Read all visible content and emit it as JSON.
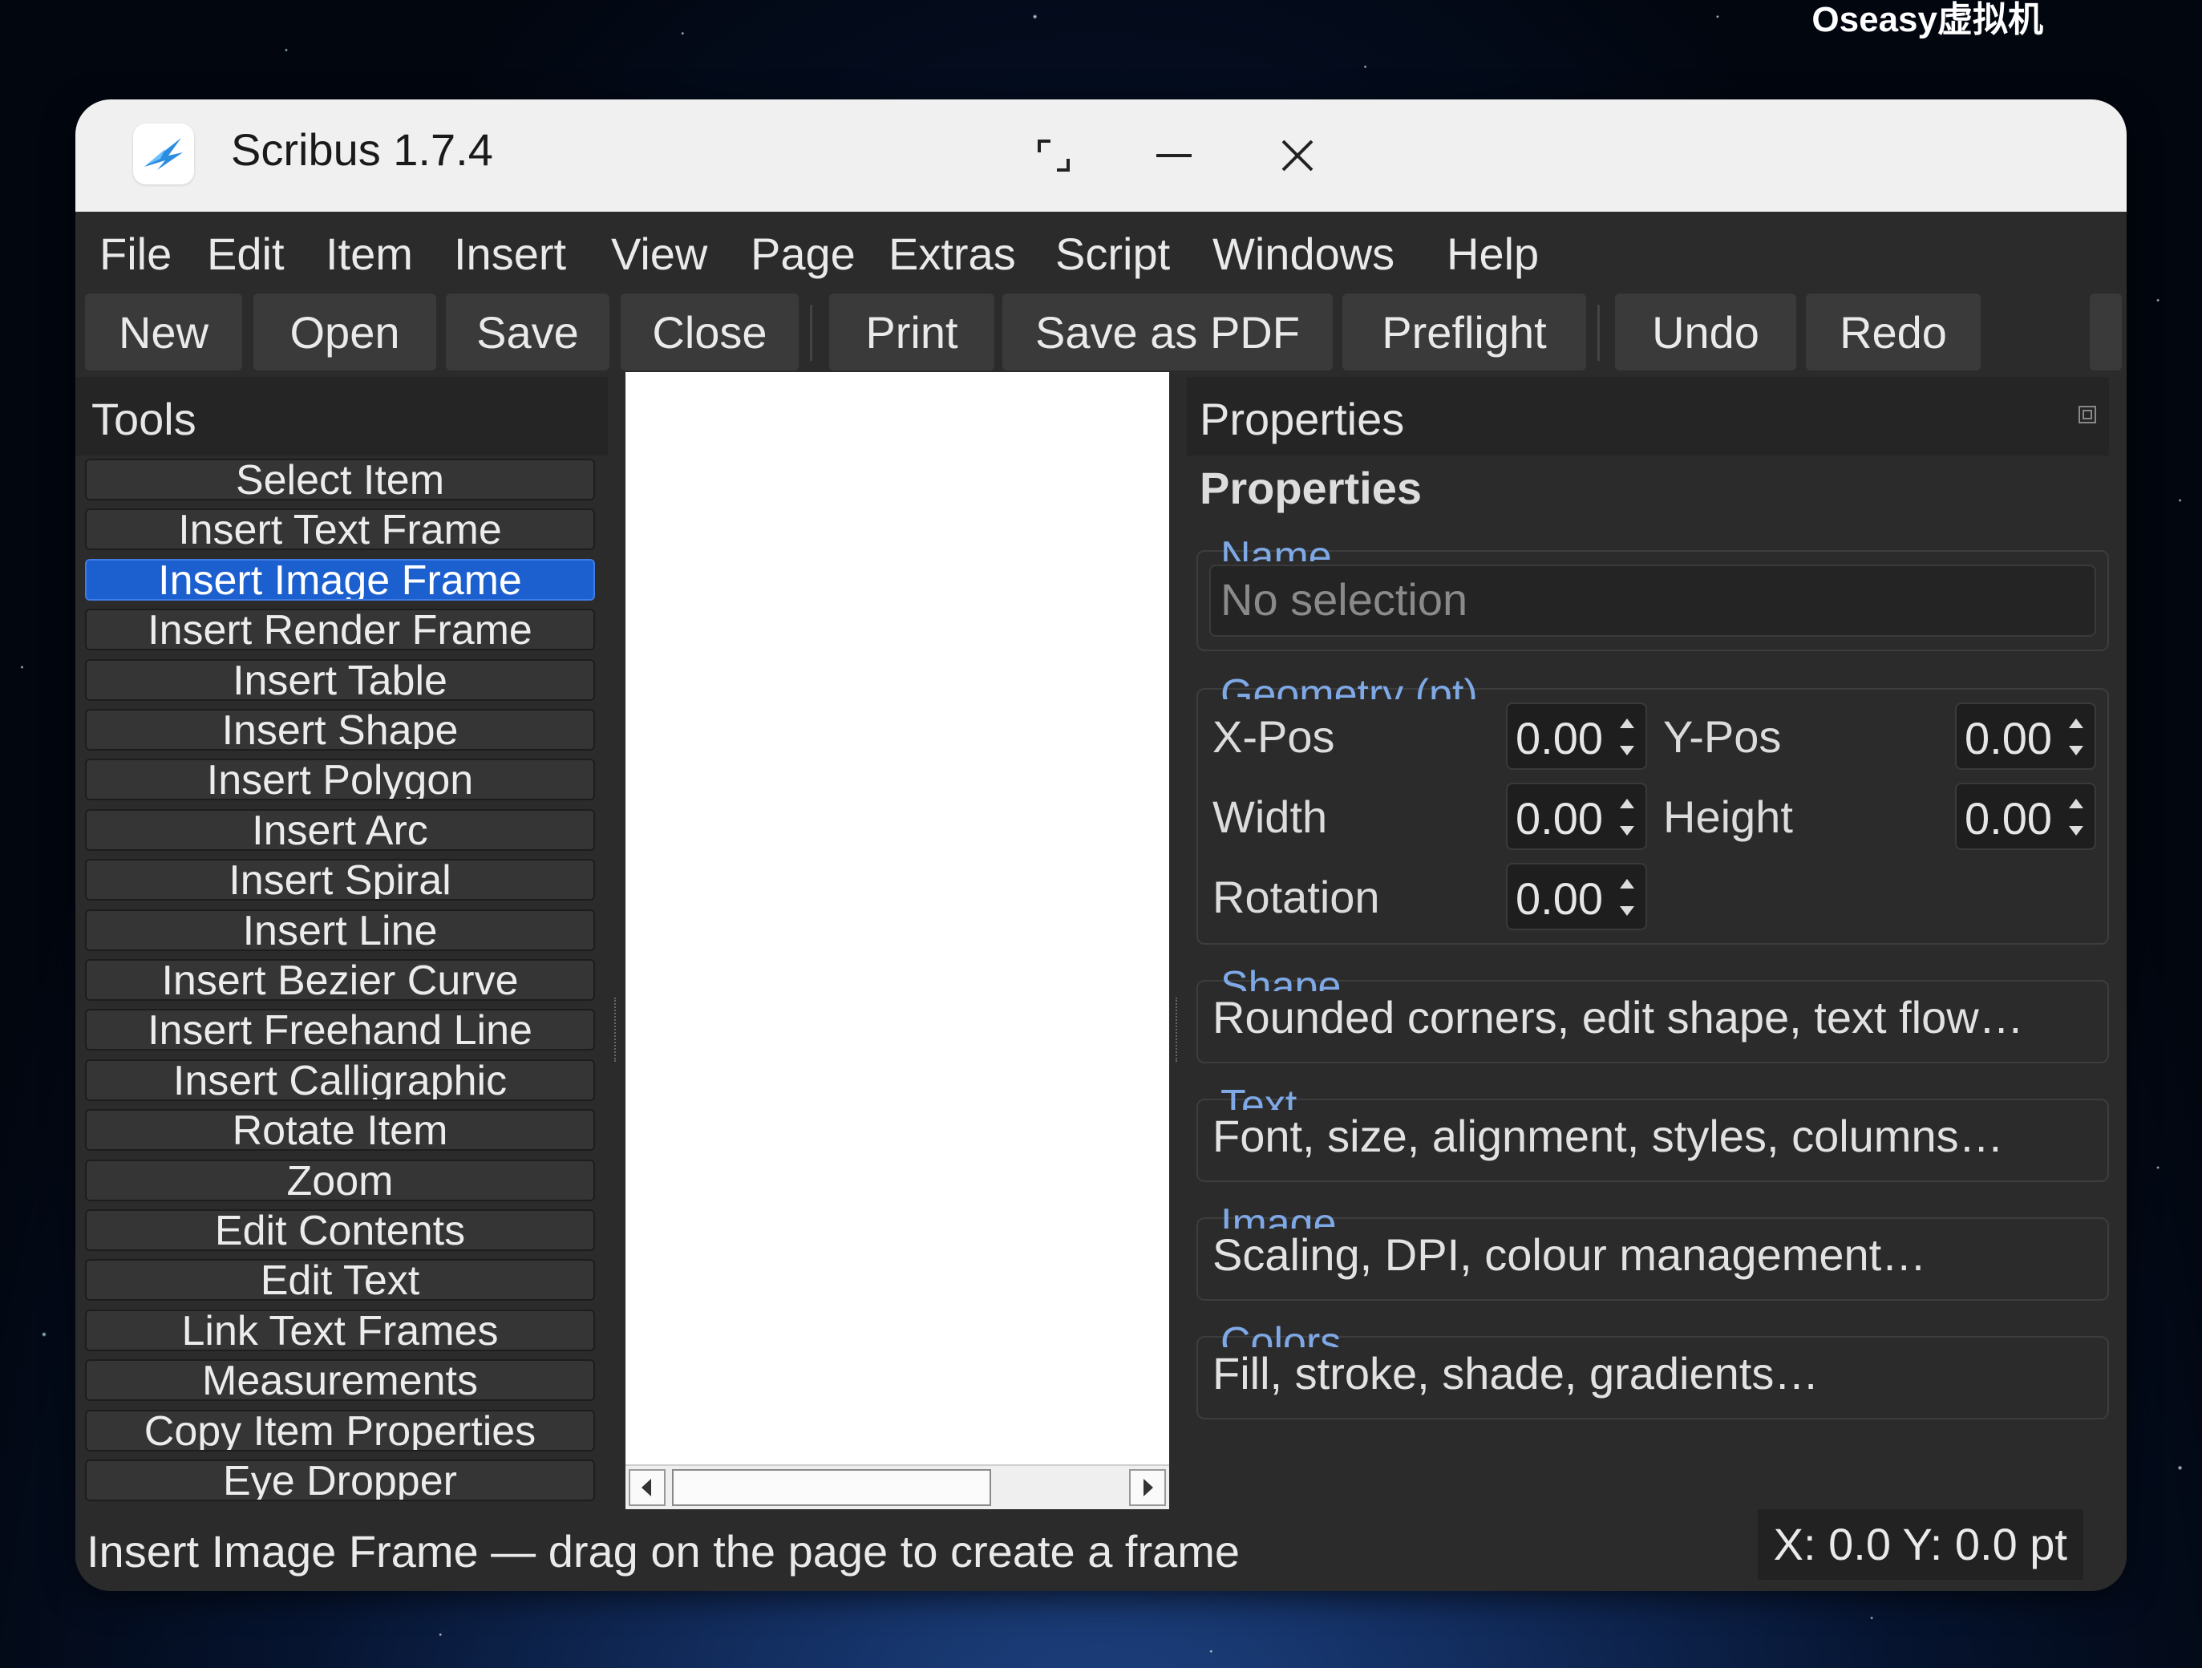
{
  "desktop": {
    "corner_label": "Oseasy虚拟机"
  },
  "window": {
    "title": "Scribus 1.7.4"
  },
  "menu": [
    "File",
    "Edit",
    "Item",
    "Insert",
    "View",
    "Page",
    "Extras",
    "Script",
    "Windows",
    "Help"
  ],
  "toolbar": {
    "new": "New",
    "open": "Open",
    "save": "Save",
    "close": "Close",
    "print": "Print",
    "save_pdf": "Save as PDF",
    "preflight": "Preflight",
    "undo": "Undo",
    "redo": "Redo"
  },
  "tools": {
    "header": "Tools",
    "items": [
      "Select Item",
      "Insert Text Frame",
      "Insert Image Frame",
      "Insert Render Frame",
      "Insert Table",
      "Insert Shape",
      "Insert Polygon",
      "Insert Arc",
      "Insert Spiral",
      "Insert Line",
      "Insert Bezier Curve",
      "Insert Freehand Line",
      "Insert Calligraphic",
      "Rotate Item",
      "Zoom",
      "Edit Contents",
      "Edit Text",
      "Link Text Frames",
      "Measurements",
      "Copy Item Properties",
      "Eye Dropper"
    ],
    "active_index": 2
  },
  "properties": {
    "header": "Properties",
    "title": "Properties",
    "name_group": "Name",
    "name_placeholder": "No selection",
    "geometry_group": "Geometry (pt)",
    "xpos_label": "X-Pos",
    "xpos_value": "0.00",
    "ypos_label": "Y-Pos",
    "ypos_value": "0.00",
    "width_label": "Width",
    "width_value": "0.00",
    "height_label": "Height",
    "height_value": "0.00",
    "rotation_label": "Rotation",
    "rotation_value": "0.00",
    "shape_group": "Shape",
    "shape_summary": "Rounded corners, edit shape, text flow…",
    "text_group": "Text",
    "text_summary": "Font, size, alignment, styles, columns…",
    "image_group": "Image",
    "image_summary": "Scaling, DPI, colour management…",
    "colors_group": "Colors",
    "colors_summary": "Fill, stroke, shade, gradients…"
  },
  "status": {
    "message": "Insert Image Frame — drag on the page to create a frame",
    "coords": "X: 0.0  Y: 0.0 pt"
  },
  "colors": {
    "accent": "#1c5fcf",
    "group_label": "#7ea8e6"
  }
}
